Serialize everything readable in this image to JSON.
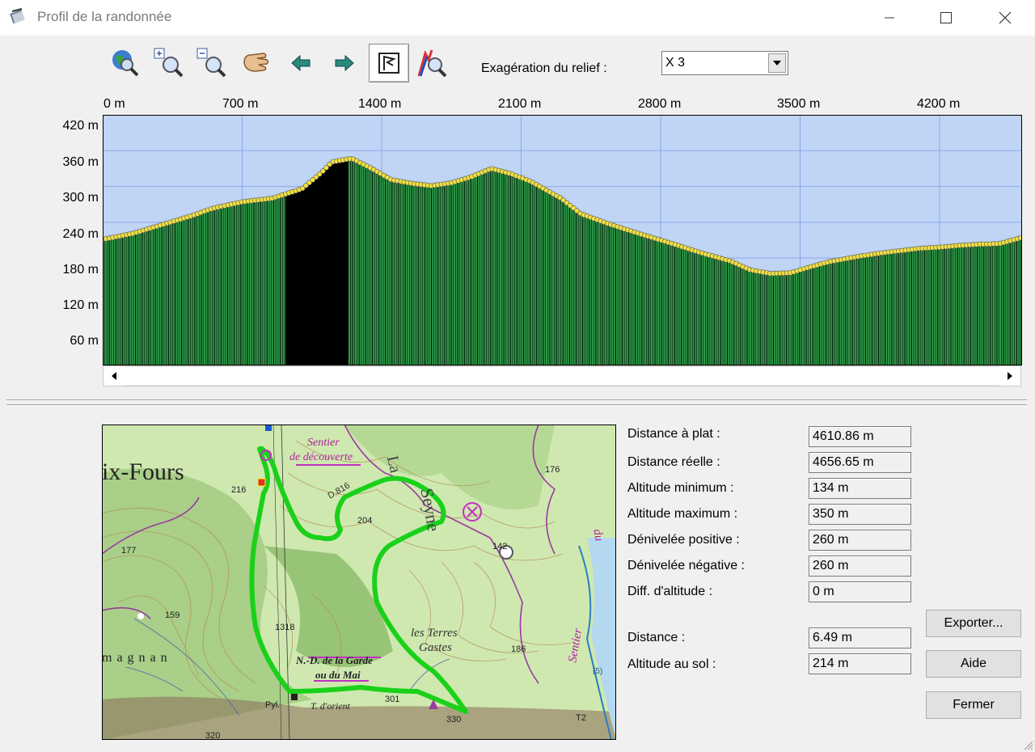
{
  "window": {
    "title": "Profil de la randonnée"
  },
  "toolbar": {
    "buttons": [
      {
        "icon": "globe-zoom-icon"
      },
      {
        "icon": "zoom-in-icon"
      },
      {
        "icon": "zoom-out-icon"
      },
      {
        "icon": "hand-pan-icon"
      },
      {
        "icon": "arrow-left-icon"
      },
      {
        "icon": "arrow-right-icon"
      },
      {
        "icon": "flag-cursor-icon",
        "pressed": true
      },
      {
        "icon": "profile-zoom-icon"
      }
    ],
    "relief_label": "Exagération du relief :",
    "relief_value": "X 3"
  },
  "chart_data": {
    "type": "area",
    "title": "",
    "xlabel": "",
    "ylabel": "",
    "xlim": [
      0,
      4610.86
    ],
    "ylim": [
      0,
      420
    ],
    "x_ticks": [
      "0 m",
      "700 m",
      "1400 m",
      "2100 m",
      "2800 m",
      "3500 m",
      "4200 m"
    ],
    "y_ticks": [
      "420 m",
      "360 m",
      "300 m",
      "240 m",
      "180 m",
      "120 m",
      "60 m"
    ],
    "grid": true,
    "series": [
      {
        "x": [
          0,
          150,
          300,
          450,
          550,
          700,
          850,
          1000,
          1100,
          1150,
          1250,
          1350,
          1450,
          1550,
          1650,
          1750,
          1850,
          1950,
          2050,
          2150,
          2300,
          2400,
          2550,
          2700,
          2850,
          3000,
          3150,
          3250,
          3350,
          3450,
          3550,
          3650,
          3800,
          3900,
          4000,
          4100,
          4200,
          4300,
          4400,
          4500,
          4610
        ],
        "y": [
          211,
          221,
          236,
          251,
          263,
          274,
          280,
          296,
          324,
          341,
          347,
          330,
          311,
          305,
          301,
          306,
          316,
          330,
          321,
          308,
          280,
          254,
          236,
          220,
          205,
          189,
          175,
          160,
          154,
          155,
          165,
          174,
          183,
          188,
          192,
          196,
          198,
          201,
          203,
          204,
          214
        ]
      }
    ]
  },
  "stats": [
    {
      "label": "Distance à plat :",
      "value": "4610.86 m"
    },
    {
      "label": "Distance réelle :",
      "value": "4656.65 m"
    },
    {
      "label": "Altitude minimum :",
      "value": "134 m"
    },
    {
      "label": "Altitude maximum :",
      "value": "350 m"
    },
    {
      "label": "Dénivelée positive :",
      "value": "260 m"
    },
    {
      "label": "Dénivelée négative :",
      "value": "260 m"
    },
    {
      "label": "Diff. d'altitude :",
      "value": "0 m"
    }
  ],
  "cursor_stats": [
    {
      "label": "Distance :",
      "value": "6.49 m"
    },
    {
      "label": "Altitude au sol :",
      "value": "214 m"
    }
  ],
  "buttons": {
    "export": "Exporter...",
    "help": "Aide",
    "close": "Fermer"
  },
  "map": {
    "labels": [
      "ix-Fours",
      "Sentier",
      "de découverte",
      "La",
      "Seyne",
      "D.816",
      "204",
      "216",
      "176",
      "142",
      "177",
      "159",
      "1318",
      "N.-D. de la Garde",
      "ou du Mai",
      "les Terres",
      "Gastes",
      "186",
      "Sentier",
      "du",
      "magnan",
      "Pyl.",
      "T. d'orient",
      "301",
      "330",
      "320",
      "T2",
      "(5)"
    ]
  },
  "colors": {
    "sky": "#c0d4f6",
    "grid": "#8aa8e6",
    "terrain": "#2e9a48",
    "marker": "#f0e040",
    "route": "#22dd22"
  }
}
